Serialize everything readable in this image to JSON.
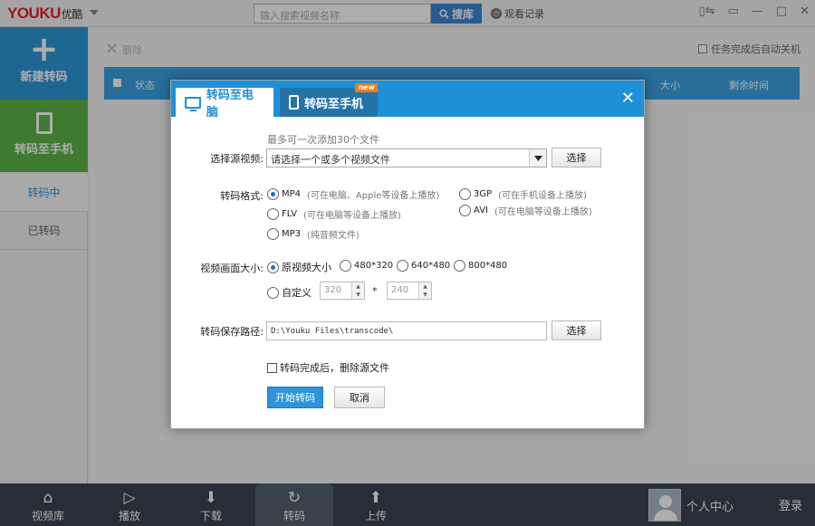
{
  "app": {
    "logo_text": "YOUKU",
    "logo_cn": "优酷",
    "search_placeholder": "输入搜索视频名称",
    "search_button": "搜库",
    "history": "观看记录"
  },
  "sidebar": {
    "new_transcode": "新建转码",
    "to_phone": "转码至手机",
    "transcoding": "转码中",
    "transcoded": "已转码"
  },
  "main": {
    "delete": "删除",
    "auto_shutdown": "任务完成后自动关机",
    "columns": [
      "状态",
      "大小",
      "剩余时间"
    ]
  },
  "bottombar": {
    "items": [
      "视频库",
      "播放",
      "下载",
      "转码",
      "上传"
    ],
    "active": "转码",
    "user": "个人中心",
    "login": "登录"
  },
  "dialog": {
    "tab_pc": "转码至电脑",
    "tab_phone": "转码至手机",
    "new_badge": "new",
    "source_hint": "最多可一次添加30个文件",
    "source_label": "选择源视频:",
    "source_placeholder": "请选择一个或多个视频文件",
    "select_button": "选择",
    "format_label": "转码格式:",
    "formats": [
      {
        "name": "MP4",
        "note": "(可在电脑、Apple等设备上播放)",
        "checked": true
      },
      {
        "name": "3GP",
        "note": "(可在手机设备上播放)",
        "checked": false
      },
      {
        "name": "FLV",
        "note": "(可在电脑等设备上播放)",
        "checked": false
      },
      {
        "name": "AVI",
        "note": "(可在电脑等设备上播放)",
        "checked": false
      },
      {
        "name": "MP3",
        "note": "(纯音频文件)",
        "checked": false
      }
    ],
    "size_label": "视频画面大小:",
    "sizes": [
      "原视频大小",
      "480*320",
      "640*480",
      "800*480"
    ],
    "custom_label": "自定义",
    "custom_width": "320",
    "custom_height": "240",
    "times": "*",
    "path_label": "转码保存路径:",
    "path_value": "D:\\Youku Files\\transcode\\",
    "delete_source": "转码完成后，删除源文件",
    "start_button": "开始转码",
    "cancel_button": "取消"
  }
}
